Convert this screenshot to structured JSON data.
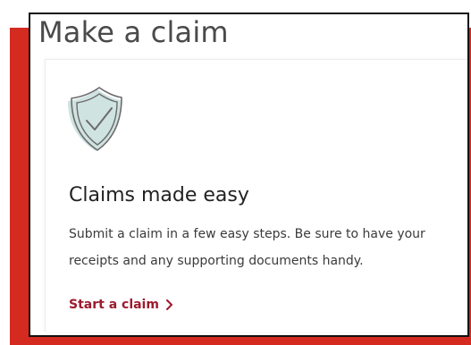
{
  "page": {
    "title": "Make a claim"
  },
  "card": {
    "icon": "shield-check-icon",
    "heading": "Claims made easy",
    "body": "Submit a claim in a few easy steps. Be sure to have your receipts and any supporting documents handy.",
    "link_label": "Start a claim",
    "link_icon": "chevron-right-icon"
  },
  "colors": {
    "accent": "#d42a20",
    "link": "#9c1b2f",
    "icon_fill": "#cfe3e0",
    "icon_stroke": "#6b6b6b"
  }
}
